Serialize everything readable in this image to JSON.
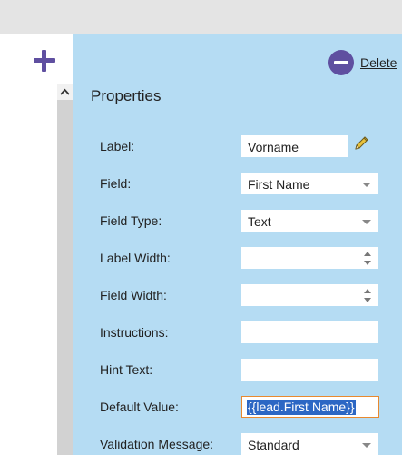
{
  "toolbar": {
    "delete_label": "Delete"
  },
  "panel": {
    "title": "Properties"
  },
  "fields": {
    "label": {
      "label": "Label:",
      "value": "Vorname"
    },
    "field": {
      "label": "Field:",
      "value": "First Name"
    },
    "field_type": {
      "label": "Field Type:",
      "value": "Text"
    },
    "label_width": {
      "label": "Label Width:",
      "value": ""
    },
    "field_width": {
      "label": "Field Width:",
      "value": ""
    },
    "instructions": {
      "label": "Instructions:",
      "value": ""
    },
    "hint_text": {
      "label": "Hint Text:",
      "value": ""
    },
    "default_value": {
      "label": "Default Value:",
      "value": "{{lead.First Name}}"
    },
    "validation_message": {
      "label": "Validation Message:",
      "value": "Standard"
    }
  },
  "icons": {
    "add": "plus-icon",
    "delete": "minus-circle-icon",
    "edit": "pencil-icon",
    "scroll_up": "chevron-up-icon"
  },
  "colors": {
    "panel_bg": "#b5dcf3",
    "accent": "#5f4fa0",
    "selection": "#2c67c4",
    "focus_border": "#e8892f"
  }
}
